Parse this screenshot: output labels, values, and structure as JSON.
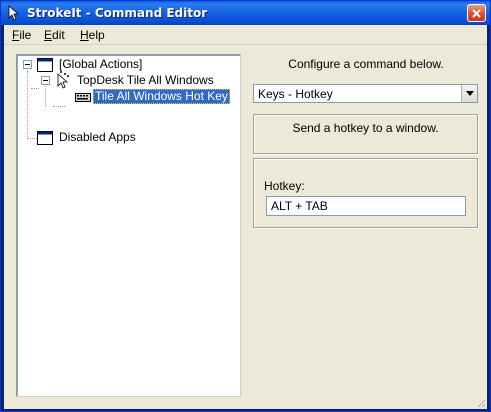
{
  "window": {
    "title": "StrokeIt - Command Editor"
  },
  "menu": {
    "items": [
      {
        "accel": "F",
        "rest": "ile"
      },
      {
        "accel": "E",
        "rest": "dit"
      },
      {
        "accel": "H",
        "rest": "elp"
      }
    ]
  },
  "tree": {
    "nodes": [
      {
        "label": "[Global Actions]",
        "icon": "window-icon",
        "expanded": true
      },
      {
        "label": "TopDesk Tile All Windows",
        "icon": "mouse-gesture-icon",
        "expanded": true
      },
      {
        "label": "Tile All Windows Hot Key",
        "icon": "keyboard-icon",
        "selected": true
      },
      {
        "label": "Disabled Apps",
        "icon": "window-icon"
      }
    ]
  },
  "config": {
    "heading": "Configure a command below.",
    "command_type": "Keys - Hotkey",
    "description": "Send a hotkey to a window.",
    "hotkey_label": "Hotkey:",
    "hotkey_value": "ALT + TAB"
  },
  "colors": {
    "titlebar": "#0a5fd8",
    "client": "#ece9d8",
    "selection": "#316ac5"
  }
}
